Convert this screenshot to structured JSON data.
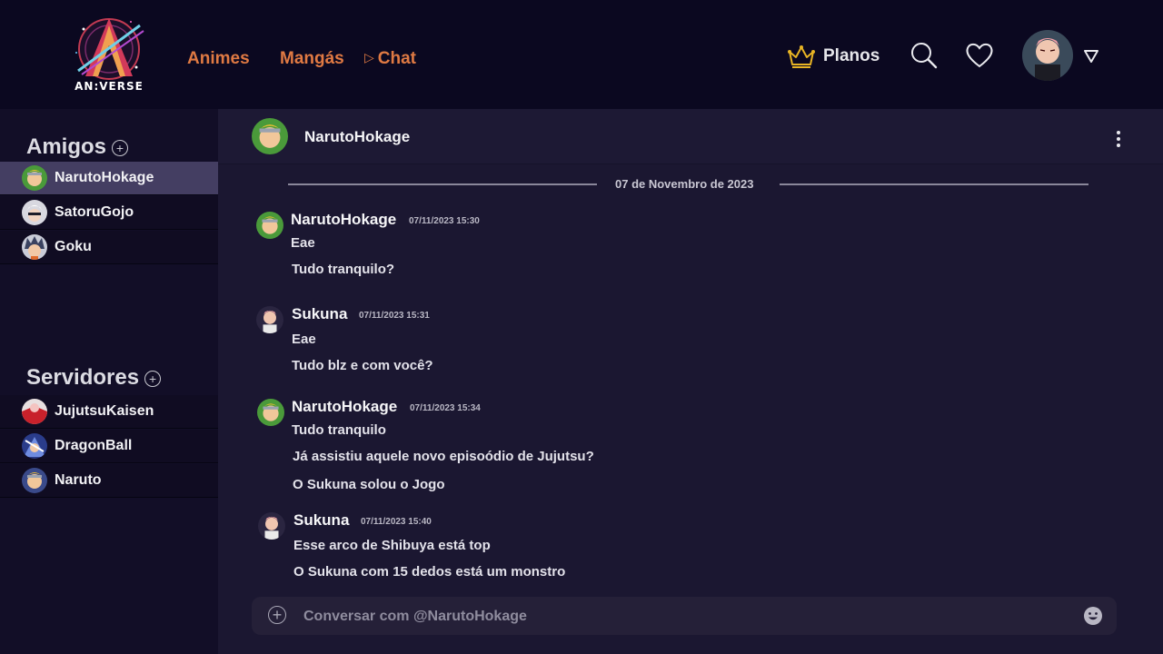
{
  "header": {
    "logo_text": "AN:VERSE",
    "nav": {
      "animes": "Animes",
      "mangas": "Mangás",
      "chat": "Chat"
    },
    "planos_label": "Planos",
    "icons": [
      "crown-icon",
      "search-icon",
      "heart-icon",
      "dropdown-triangle-icon"
    ]
  },
  "sidebar": {
    "friends_title": "Amigos",
    "friends": [
      {
        "name": "NarutoHokage",
        "active": true
      },
      {
        "name": "SatoruGojo",
        "active": false
      },
      {
        "name": "Goku",
        "active": false
      }
    ],
    "servers_title": "Servidores",
    "servers": [
      {
        "name": "JujutsuKaisen"
      },
      {
        "name": "DragonBall"
      },
      {
        "name": "Naruto"
      }
    ]
  },
  "chat": {
    "header_name": "NarutoHokage",
    "date_separator": "07 de Novembro de 2023",
    "messages": [
      {
        "author": "NarutoHokage",
        "time": "07/11/2023 15:30",
        "lines": [
          "Eae",
          "Tudo tranquilo?"
        ]
      },
      {
        "author": "Sukuna",
        "time": "07/11/2023 15:31",
        "lines": [
          "Eae",
          "Tudo blz e com você?"
        ]
      },
      {
        "author": "NarutoHokage",
        "time": "07/11/2023 15:34",
        "lines": [
          "Tudo tranquilo",
          "Já assistiu aquele novo episoódio de Jujutsu?",
          "O Sukuna solou o Jogo"
        ]
      },
      {
        "author": "Sukuna",
        "time": "07/11/2023 15:40",
        "lines": [
          "Esse arco de Shibuya está top",
          "O Sukuna com 15 dedos está um monstro"
        ]
      }
    ],
    "composer_placeholder": "Conversar com @NarutoHokage"
  },
  "colors": {
    "nav_accent": "#e07a43",
    "crown": "#e8b424",
    "active_item": "#443e62",
    "background": "#0d0a1f"
  }
}
